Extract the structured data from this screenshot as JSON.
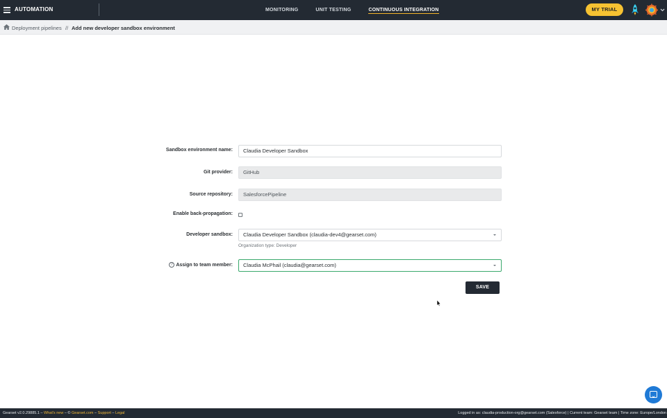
{
  "header": {
    "app_title": "AUTOMATION",
    "tabs": [
      {
        "label": "MONITORING",
        "active": false
      },
      {
        "label": "UNIT TESTING",
        "active": false
      },
      {
        "label": "CONTINUOUS INTEGRATION",
        "active": true
      }
    ],
    "trial_label": "MY TRIAL",
    "icons": [
      "hamburger-menu-icon",
      "rocket-icon",
      "avatar-icon",
      "chevron-down-icon"
    ]
  },
  "breadcrumb": {
    "home_icon": "home-icon",
    "link": "Deployment pipelines",
    "separator": "//",
    "current": "Add new developer sandbox environment"
  },
  "form": {
    "sandbox_name": {
      "label": "Sandbox environment name:",
      "value": "Claudia Developer Sandbox"
    },
    "git_provider": {
      "label": "Git provider:",
      "value": "GitHub"
    },
    "source_repository": {
      "label": "Source repository:",
      "value": "SalesforcePipeline"
    },
    "back_propagation": {
      "label": "Enable back-propagation:",
      "checked": false
    },
    "developer_sandbox": {
      "label": "Developer sandbox:",
      "value": "Claudia Developer Sandbox (claudia-dev4@gearset.com)",
      "hint": "Organization type: Developer"
    },
    "team_member": {
      "label": "Assign to team member:",
      "value": "Claudia McPhail (claudia@gearset.com)",
      "help": "?"
    },
    "save_label": "SAVE"
  },
  "footer": {
    "version": "Gearset v2.0.29885.1",
    "dash1": " – ",
    "whats_new": "What's new",
    "dash2": " – © ",
    "gearset_com": "Gearset.com",
    "dash3": " – ",
    "support": "Support",
    "dash4": " – ",
    "legal": "Legal",
    "right": "Logged in as: claudia-production-org@gearset.com (Salesforce) | Current team: Gearset team | Time zone: Europe/London"
  },
  "colors": {
    "nav_bg": "#232a33",
    "accent_yellow": "#f6c232",
    "focus_green": "#38a86b",
    "chat_blue": "#1f7ad6"
  }
}
